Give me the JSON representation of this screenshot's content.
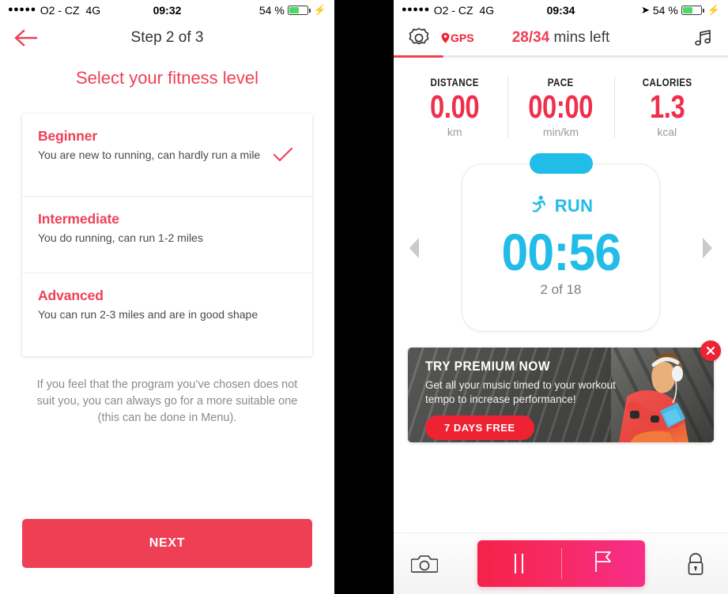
{
  "left_phone": {
    "status_bar": {
      "signal_dots": "●●●●●",
      "carrier": "O2 - CZ",
      "network": "4G",
      "time": "09:32",
      "battery_pct": "54 %",
      "charging_icon": "lightning-bolt-icon"
    },
    "nav": {
      "back_icon": "back-arrow-icon",
      "title": "Step 2 of 3"
    },
    "heading": "Select your fitness level",
    "levels": [
      {
        "title": "Beginner",
        "desc": "You are new to running, can hardly run a mile",
        "selected": true
      },
      {
        "title": "Intermediate",
        "desc": "You do running, can run 1-2 miles",
        "selected": false
      },
      {
        "title": "Advanced",
        "desc": "You can run 2-3 miles and are in good shape",
        "selected": false
      }
    ],
    "footnote": "If you feel that the program you’ve chosen does not suit you, you can always go for a more suitable one (this can be done in Menu).",
    "next_button": "NEXT",
    "colors": {
      "accent": "#ef3f55",
      "title_text": "#333333",
      "body_text": "#4a4a4a",
      "muted_text": "#8b8b8b"
    }
  },
  "right_phone": {
    "status_bar": {
      "signal_dots": "●●●●●",
      "carrier": "O2 - CZ",
      "network": "4G",
      "time": "09:34",
      "location_icon": "location-arrow-icon",
      "battery_pct": "54 %",
      "charging_icon": "lightning-bolt-icon"
    },
    "header": {
      "settings_icon": "gear-icon",
      "gps_icon": "location-pin-icon",
      "gps_label": "GPS",
      "time_left_value": "28/34",
      "time_left_suffix": "mins left",
      "music_icon": "music-note-icon"
    },
    "progress": {
      "percent": 15
    },
    "metrics": [
      {
        "label": "DISTANCE",
        "value": "0.00",
        "unit": "km"
      },
      {
        "label": "PACE",
        "value": "00:00",
        "unit": "min/km"
      },
      {
        "label": "CALORIES",
        "value": "1.3",
        "unit": "kcal"
      }
    ],
    "timer_card": {
      "prev_icon": "chevron-left-icon",
      "next_icon": "chevron-right-icon",
      "activity_icon": "running-person-icon",
      "activity_label": "RUN",
      "time": "00:56",
      "interval": "2 of 18"
    },
    "banner": {
      "title": "TRY PREMIUM NOW",
      "subtitle": "Get all your music timed to your workout tempo to increase performance!",
      "cta": "7 DAYS FREE",
      "close_icon": "close-icon",
      "photo_alt": "runner-with-headphones-photo"
    },
    "bottom_bar": {
      "camera_icon": "camera-icon",
      "pause_icon": "pause-icon",
      "flag_icon": "flag-icon",
      "lock_icon": "lock-icon"
    },
    "colors": {
      "accent": "#ef3f55",
      "metric_value": "#ef2f4b",
      "cyan": "#22bce8",
      "gps_red": "#ef2233"
    }
  }
}
